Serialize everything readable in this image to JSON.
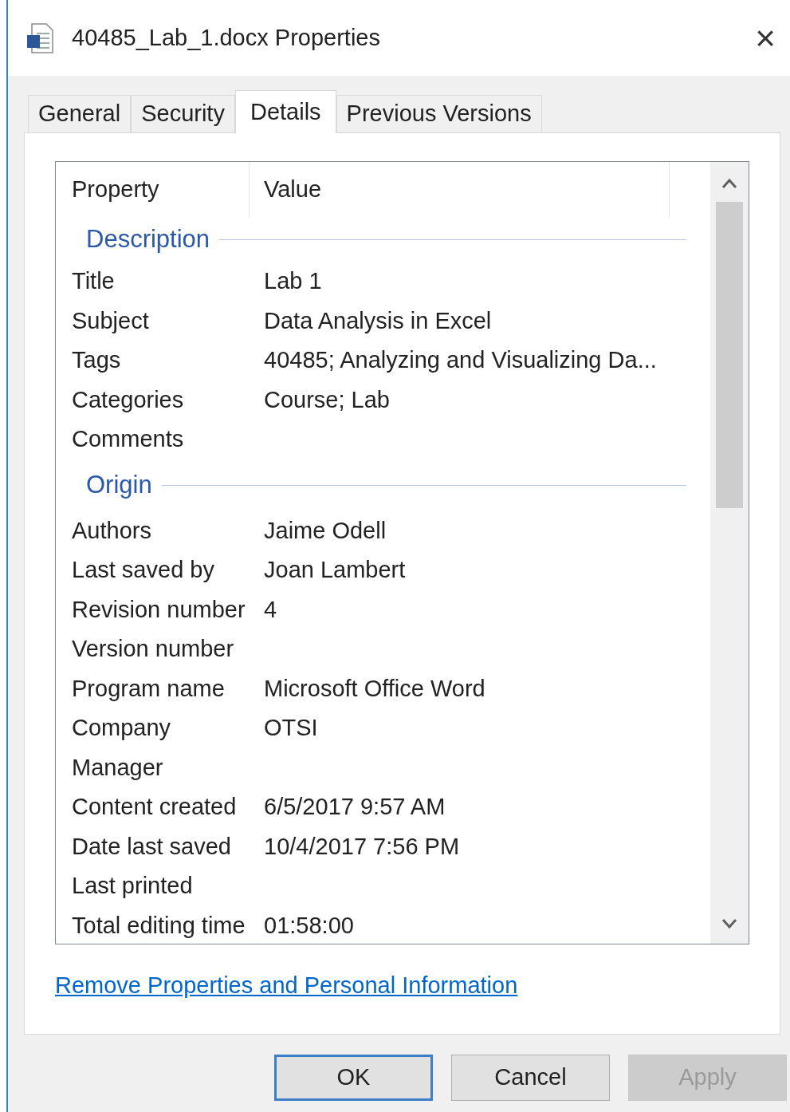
{
  "window": {
    "title": "40485_Lab_1.docx Properties",
    "close": "×"
  },
  "tabs": [
    {
      "label": "General",
      "selected": false
    },
    {
      "label": "Security",
      "selected": false
    },
    {
      "label": "Details",
      "selected": true
    },
    {
      "label": "Previous Versions",
      "selected": false
    }
  ],
  "table": {
    "columns": [
      "Property",
      "Value"
    ],
    "groups": [
      {
        "name": "Description",
        "rows": [
          {
            "property": "Title",
            "value": "Lab 1"
          },
          {
            "property": "Subject",
            "value": "Data Analysis in Excel"
          },
          {
            "property": "Tags",
            "value": "40485; Analyzing and Visualizing Da..."
          },
          {
            "property": "Categories",
            "value": "Course; Lab"
          },
          {
            "property": "Comments"
          }
        ]
      },
      {
        "name": "Origin",
        "rows": [
          {
            "property": "Authors",
            "value": "Jaime Odell"
          },
          {
            "property": "Last saved by",
            "value": "Joan Lambert"
          },
          {
            "property": "Revision number",
            "value": "4"
          },
          {
            "property": "Version number"
          },
          {
            "property": "Program name",
            "value": "Microsoft Office Word"
          },
          {
            "property": "Company",
            "value": "OTSI"
          },
          {
            "property": "Manager"
          },
          {
            "property": "Content created",
            "value": "6/5/2017 9:57 AM"
          },
          {
            "property": "Date last saved",
            "value": "10/4/2017 7:56 PM"
          },
          {
            "property": "Last printed"
          },
          {
            "property": "Total editing time",
            "value": "01:58:00"
          }
        ]
      }
    ]
  },
  "link": "Remove Properties and Personal Information",
  "buttons": [
    {
      "label": "OK",
      "default": true,
      "disabled": false
    },
    {
      "label": "Cancel",
      "default": false,
      "disabled": false
    },
    {
      "label": "Apply",
      "default": false,
      "disabled": true
    }
  ]
}
